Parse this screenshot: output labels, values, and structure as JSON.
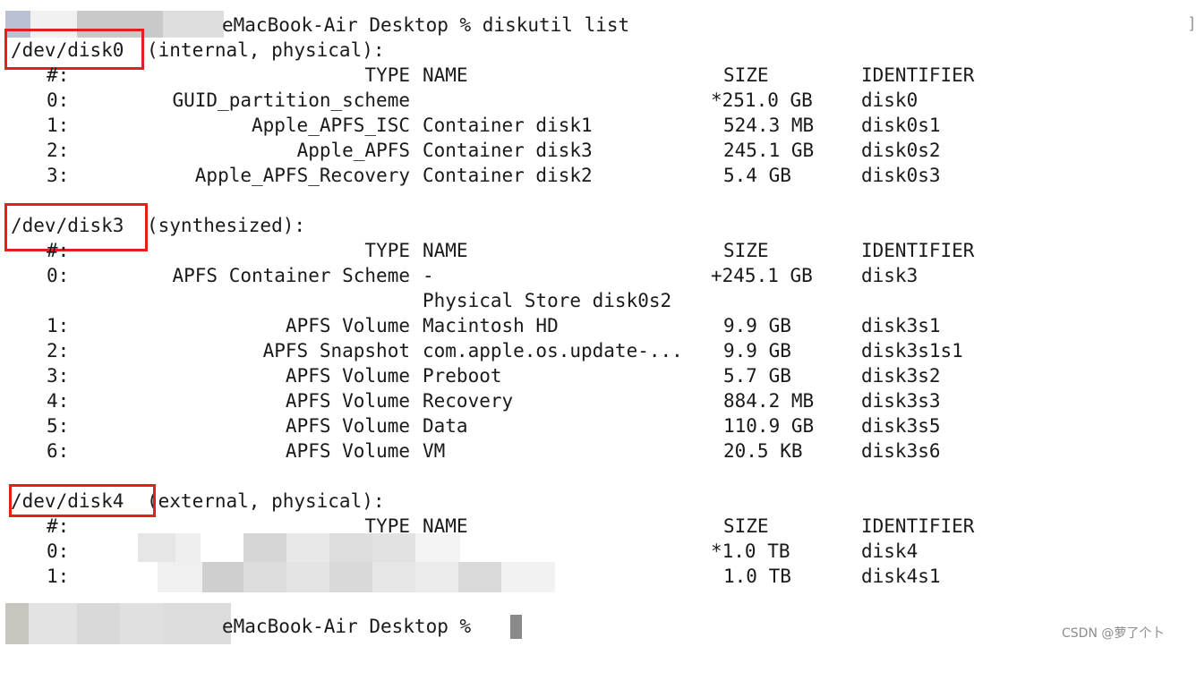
{
  "terminal": {
    "command_prompt": "eMacBook-Air Desktop % diskutil list",
    "final_prompt": "eMacBook-Air Desktop %",
    "edge_bracket": "]",
    "disks": [
      {
        "device": "/dev/disk0",
        "description": "(internal, physical):",
        "header": {
          "num": "#:",
          "type": "TYPE",
          "name": "NAME",
          "size": "SIZE",
          "identifier": "IDENTIFIER"
        },
        "rows": [
          {
            "num": "0:",
            "type": "GUID_partition_scheme",
            "name": "",
            "size": "*251.0 GB",
            "identifier": "disk0"
          },
          {
            "num": "1:",
            "type": "Apple_APFS_ISC",
            "name": "Container disk1",
            "size": "524.3 MB",
            "identifier": "disk0s1"
          },
          {
            "num": "2:",
            "type": "Apple_APFS",
            "name": "Container disk3",
            "size": "245.1 GB",
            "identifier": "disk0s2"
          },
          {
            "num": "3:",
            "type": "Apple_APFS_Recovery",
            "name": "Container disk2",
            "size": "5.4 GB",
            "identifier": "disk0s3"
          }
        ]
      },
      {
        "device": "/dev/disk3",
        "description": "(synthesized):",
        "header": {
          "num": "#:",
          "type": "TYPE",
          "name": "NAME",
          "size": "SIZE",
          "identifier": "IDENTIFIER"
        },
        "rows": [
          {
            "num": "0:",
            "type": "APFS Container Scheme",
            "name": "-",
            "size": "+245.1 GB",
            "identifier": "disk3"
          },
          {
            "num": "",
            "type": "",
            "name": "Physical Store disk0s2",
            "size": "",
            "identifier": ""
          },
          {
            "num": "1:",
            "type": "APFS Volume",
            "name": "Macintosh HD",
            "size": "9.9 GB",
            "identifier": "disk3s1"
          },
          {
            "num": "2:",
            "type": "APFS Snapshot",
            "name": "com.apple.os.update-...",
            "size": "9.9 GB",
            "identifier": "disk3s1s1"
          },
          {
            "num": "3:",
            "type": "APFS Volume",
            "name": "Preboot",
            "size": "5.7 GB",
            "identifier": "disk3s2"
          },
          {
            "num": "4:",
            "type": "APFS Volume",
            "name": "Recovery",
            "size": "884.2 MB",
            "identifier": "disk3s3"
          },
          {
            "num": "5:",
            "type": "APFS Volume",
            "name": "Data",
            "size": "110.9 GB",
            "identifier": "disk3s5"
          },
          {
            "num": "6:",
            "type": "APFS Volume",
            "name": "VM",
            "size": "20.5 KB",
            "identifier": "disk3s6"
          }
        ]
      },
      {
        "device": "/dev/disk4",
        "description": "(external, physical):",
        "header": {
          "num": "#:",
          "type": "TYPE",
          "name": "NAME",
          "size": "SIZE",
          "identifier": "IDENTIFIER"
        },
        "rows": [
          {
            "num": "0:",
            "type": "",
            "name": "",
            "size": "*1.0 TB",
            "identifier": "disk4"
          },
          {
            "num": "1:",
            "type": "",
            "name": "",
            "size": "1.0 TB",
            "identifier": "disk4s1"
          }
        ]
      }
    ]
  },
  "watermark": "CSDN @萝了个卜",
  "colors": {
    "highlight_box": "#e3201b",
    "background": "#ffffff",
    "text": "#1a1a1a",
    "cursor": "#8a8a8a"
  }
}
